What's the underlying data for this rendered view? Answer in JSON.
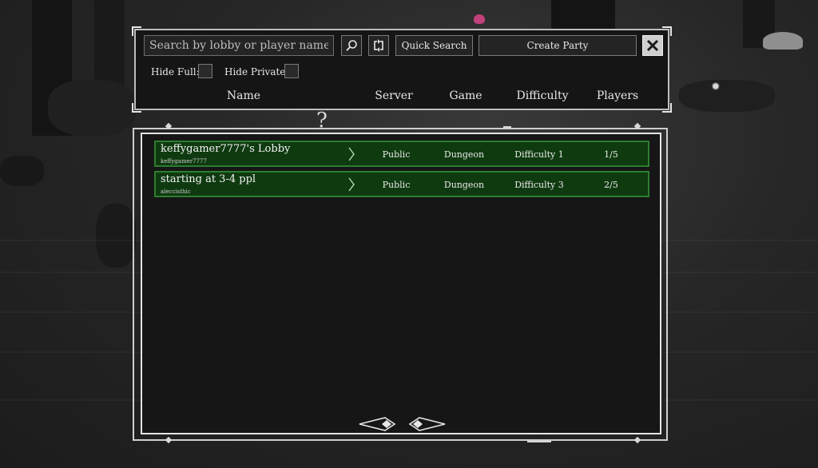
{
  "search": {
    "placeholder": "Search by lobby or player name..."
  },
  "toolbar": {
    "search_icon": "magnifier-icon",
    "refresh_icon": "refresh-icon",
    "quick_search_label": "Quick Search",
    "create_party_label": "Create Party",
    "close_icon": "close-x-icon"
  },
  "filters": {
    "hide_full_label": "Hide Full:",
    "hide_private_label": "Hide Private:"
  },
  "columns": [
    "Name",
    "Server",
    "Game",
    "Difficulty",
    "Players"
  ],
  "lobbies": [
    {
      "name": "keffygamer7777's Lobby",
      "owner": "keffygamer7777",
      "server": "Public",
      "game": "Dungeon",
      "difficulty": "Difficulty 1",
      "players": "1/5"
    },
    {
      "name": "starting at 3-4 ppl",
      "owner": "aleccisthic",
      "server": "Public",
      "game": "Dungeon",
      "difficulty": "Difficulty 3",
      "players": "2/5"
    }
  ],
  "pagination": {
    "prev_icon": "arrow-left-icon",
    "next_icon": "arrow-right-icon"
  },
  "colors": {
    "row_bg": "#0f3a10",
    "row_border": "#2d7d2f",
    "panel_bg": "#161616"
  }
}
